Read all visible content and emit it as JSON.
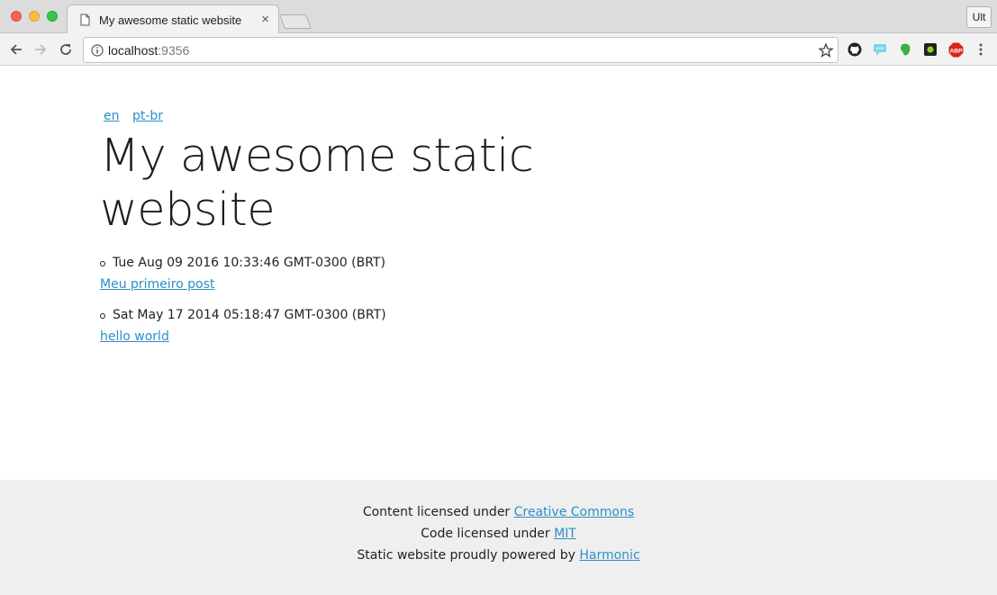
{
  "browser": {
    "tab_title": "My awesome static website",
    "tab_close": "×",
    "profile_button": "Ult",
    "url_host": "localhost",
    "url_port": ":9356",
    "extensions": [
      "github-icon",
      "chat-icon",
      "evernote-icon",
      "green-extension-icon",
      "adblock-plus-icon",
      "menu-icon"
    ],
    "abp_label": "ABP"
  },
  "page": {
    "languages": [
      {
        "label": "en"
      },
      {
        "label": "pt-br"
      }
    ],
    "title": "My awesome static website",
    "posts": [
      {
        "date": "Tue Aug 09 2016 10:33:46 GMT-0300 (BRT)",
        "title": "Meu primeiro post"
      },
      {
        "date": "Sat May 17 2014 05:18:47 GMT-0300 (BRT)",
        "title": "hello world"
      }
    ]
  },
  "footer": {
    "content_prefix": "Content licensed under ",
    "content_link": "Creative Commons",
    "code_prefix": "Code licensed under ",
    "code_link": "MIT",
    "powered_prefix": "Static website proudly powered by ",
    "powered_link": "Harmonic"
  },
  "colors": {
    "link": "#2a8fc7",
    "footer_bg": "#efefef"
  }
}
